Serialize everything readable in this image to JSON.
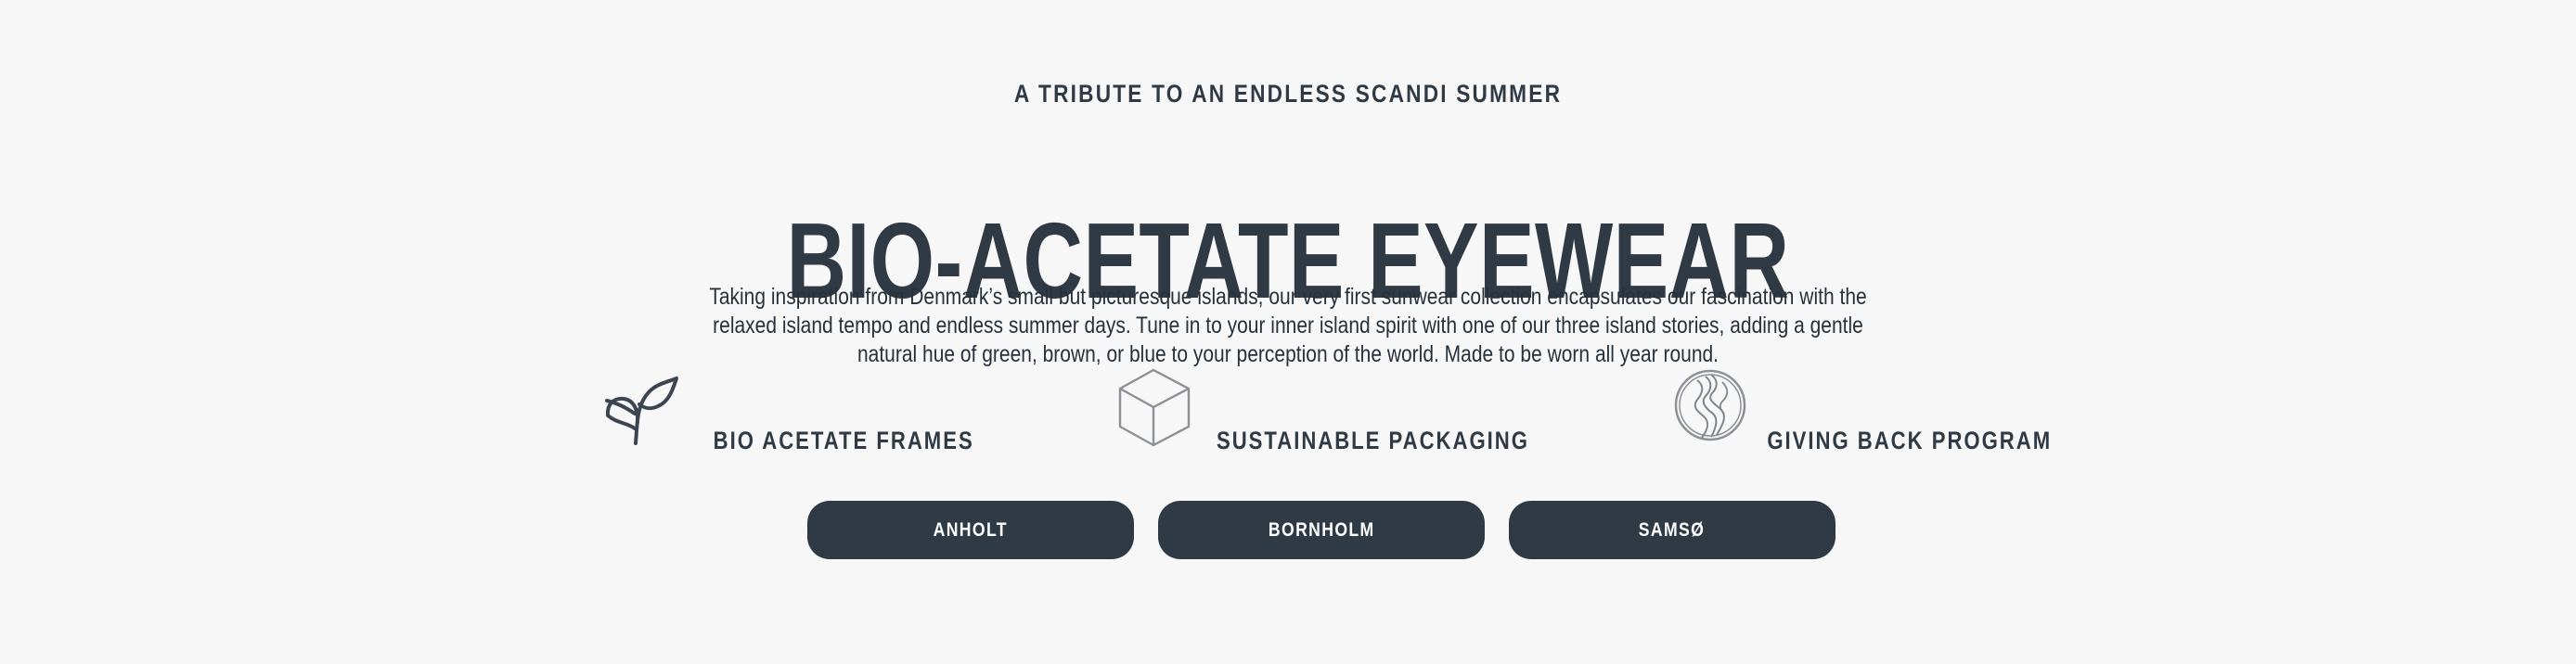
{
  "hero": {
    "eyebrow": "A TRIBUTE TO AN ENDLESS SCANDI SUMMER",
    "headline": "BIO-ACETATE EYEWEAR",
    "description": "Taking inspiration from Denmark’s small but picturesque islands, our very first sunwear collection encapsulates our fascination with the relaxed island tempo and endless summer days. Tune in to your inner island spirit with one of our three island stories, adding a gentle natural hue of green, brown, or blue to your perception of the world. Made to be worn all year round."
  },
  "features": [
    {
      "label": "BIO ACETATE FRAMES",
      "icon": "sprout-icon"
    },
    {
      "label": "SUSTAINABLE PACKAGING",
      "icon": "box-icon"
    },
    {
      "label": "GIVING BACK PROGRAM",
      "icon": "globe-icon"
    }
  ],
  "buttons": [
    {
      "label": "ANHOLT"
    },
    {
      "label": "BORNHOLM"
    },
    {
      "label": "SAMSØ"
    }
  ],
  "colors": {
    "background": "#f7f7f7",
    "text": "#2f3a45",
    "button": "#2f3a45",
    "button_text": "#ffffff",
    "icon_stroke": "#8d9094"
  }
}
